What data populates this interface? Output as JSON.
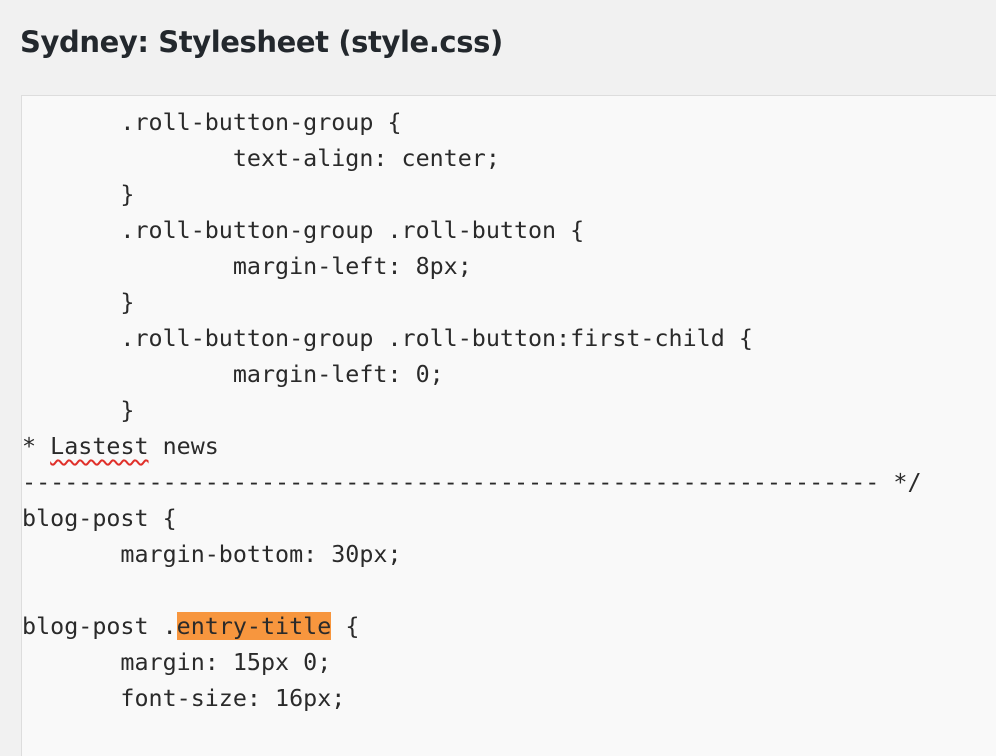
{
  "header": {
    "title": "Sydney: Stylesheet (style.css)"
  },
  "editor": {
    "lines": [
      {
        "a": "        .roll-button-group {"
      },
      {
        "a": "                text-align: center;"
      },
      {
        "a": "        }"
      },
      {
        "a": "        .roll-button-group .roll-button {"
      },
      {
        "a": "                margin-left: 8px;"
      },
      {
        "a": "        }"
      },
      {
        "a": "        .roll-button-group .roll-button:first-child {"
      },
      {
        "a": "                margin-left: 0;"
      },
      {
        "a": "        }"
      },
      {
        "a": "/* ",
        "b": "Lastest",
        "c": " news"
      },
      {
        "a": "-------------------------------------------------------------- */"
      },
      {
        "a": ".blog-post {"
      },
      {
        "a": "        margin-bottom: 30px;"
      },
      {
        "a": "}"
      },
      {
        "a": ".blog-post .",
        "b": "entry-title",
        "c": " {"
      },
      {
        "a": "        margin: 15px 0;"
      },
      {
        "a": "        font-size: 16px;"
      },
      {
        "a": "}"
      }
    ]
  },
  "colors": {
    "search_highlight": "#f7963e",
    "spellcheck_underline": "#e0302a",
    "editor_background": "#f9f9f9",
    "page_background": "#f1f1f1"
  }
}
